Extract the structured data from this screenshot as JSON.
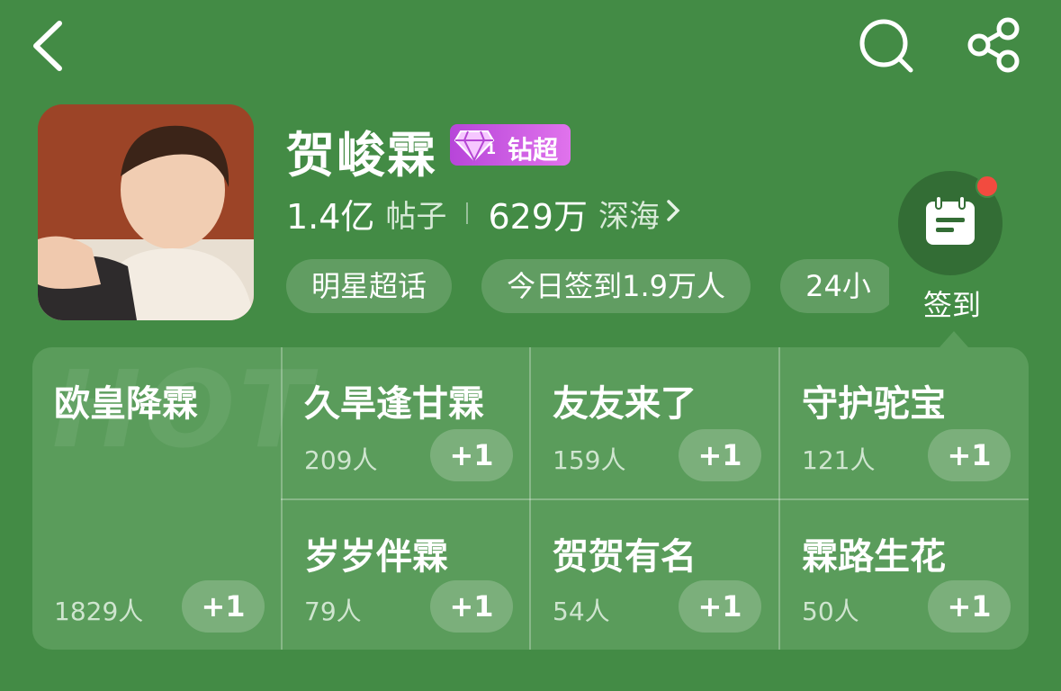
{
  "header": {
    "back_icon": "chevron-left-icon",
    "search_icon": "search-icon",
    "share_icon": "share-icon"
  },
  "profile": {
    "title": "贺峻霖",
    "badge_level": "1",
    "badge_label": "钻超",
    "posts_count": "1.4亿",
    "posts_label": "帖子",
    "fans_count": "629万",
    "fans_label": "深海",
    "chips": [
      "明星超话",
      "今日签到1.9万人",
      "24小"
    ],
    "checkin_label": "签到"
  },
  "panel": {
    "hot_watermark": "HOT",
    "featured": {
      "name": "欧皇降霖",
      "count": "1829人",
      "action": "+1"
    },
    "cells": [
      {
        "name": "久旱逢甘霖",
        "count": "209人",
        "action": "+1"
      },
      {
        "name": "友友来了",
        "count": "159人",
        "action": "+1"
      },
      {
        "name": "守护驼宝",
        "count": "121人",
        "action": "+1"
      },
      {
        "name": "岁岁伴霖",
        "count": "79人",
        "action": "+1"
      },
      {
        "name": "贺贺有名",
        "count": "54人",
        "action": "+1"
      },
      {
        "name": "霖路生花",
        "count": "50人",
        "action": "+1"
      }
    ]
  },
  "colors": {
    "background": "#438b45",
    "panel": "#5a9c5b",
    "badge": "#c24ee0",
    "notification_dot": "#f24b3f"
  }
}
